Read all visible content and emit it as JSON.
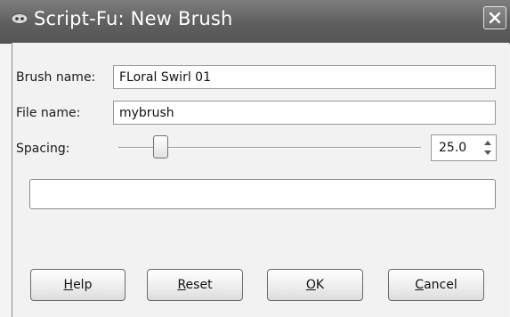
{
  "window": {
    "title": "Script-Fu: New Brush",
    "icon": "script-fu-icon"
  },
  "form": {
    "brush_name": {
      "label": "Brush name:",
      "value": "FLoral Swirl 01"
    },
    "file_name": {
      "label": "File name:",
      "value": "mybrush"
    },
    "spacing": {
      "label": "Spacing:",
      "value": "25.0"
    }
  },
  "buttons": {
    "help": {
      "mnemonic": "H",
      "rest": "elp"
    },
    "reset": {
      "mnemonic": "R",
      "rest": "eset"
    },
    "ok": {
      "mnemonic": "O",
      "rest": "K"
    },
    "cancel": {
      "mnemonic": "C",
      "rest": "ancel"
    }
  }
}
